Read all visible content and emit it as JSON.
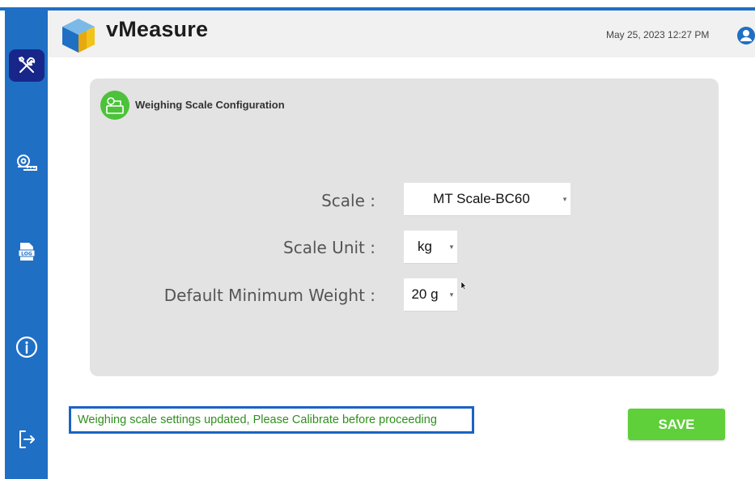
{
  "app": {
    "title": "vMeasure"
  },
  "header": {
    "datetime": "May 25, 2023 12:27 PM",
    "user_icon": "user-icon"
  },
  "sidebar": {
    "items": [
      {
        "icon": "tools-icon",
        "active": true
      },
      {
        "icon": "tape-measure-icon",
        "active": false
      },
      {
        "icon": "log-file-icon",
        "active": false
      },
      {
        "icon": "info-icon",
        "active": false
      },
      {
        "icon": "logout-icon",
        "active": false
      }
    ],
    "color": "#1f6fc5",
    "active_color": "#18268a"
  },
  "config": {
    "title": "Weighing Scale Configuration",
    "icon": "weighing-scale-icon",
    "fields": {
      "scale": {
        "label": "Scale :",
        "value": "MT Scale-BC60"
      },
      "unit": {
        "label": "Scale Unit :",
        "value": "kg"
      },
      "min_weight": {
        "label": "Default Minimum Weight :",
        "value": "20 g"
      }
    }
  },
  "status": {
    "message": "Weighing scale settings updated, Please Calibrate before proceeding",
    "color": "#2f8f1e"
  },
  "actions": {
    "save_label": "SAVE",
    "save_color": "#5fcf3a"
  }
}
